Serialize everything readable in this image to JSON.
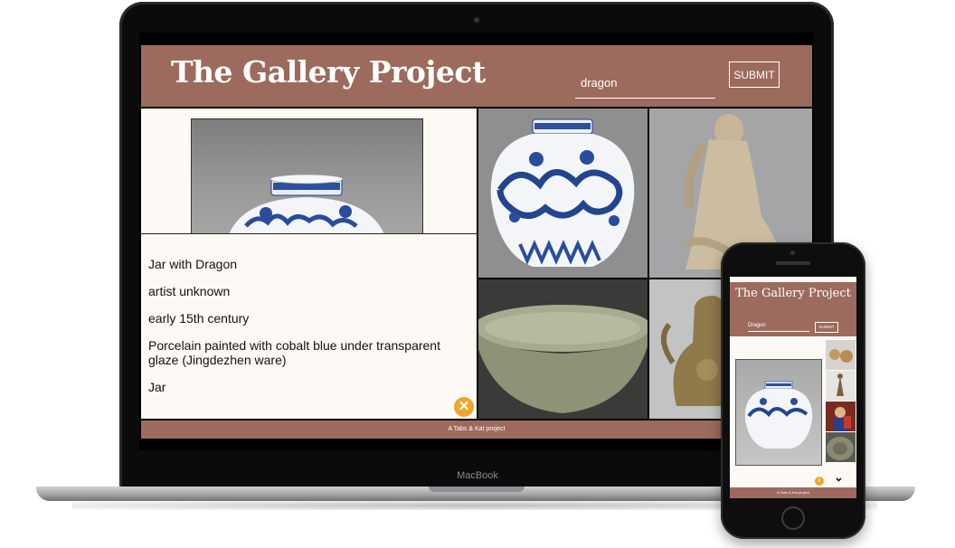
{
  "laptop": {
    "brand_label": "MacBook"
  },
  "site": {
    "title": "The Gallery Project",
    "search": {
      "value": "dragon",
      "placeholder": ""
    },
    "submit_label": "SUBMIT",
    "footer_text": "A Tabs & Kat project"
  },
  "artwork": {
    "title": "Jar with Dragon",
    "artist": "artist unknown",
    "date": "early 15th century",
    "medium": "Porcelain painted with cobalt blue under transparent glaze (Jingdezhen ware)",
    "classification": "Jar",
    "close_icon": "close-icon",
    "close_glyph": "✕"
  },
  "thumbnails": [
    {
      "subject": "blue and white porcelain jar with dragon"
    },
    {
      "subject": "stone sculpture of seated figure"
    },
    {
      "subject": "celadon bowl"
    },
    {
      "subject": "bronze ewer"
    }
  ],
  "phone": {
    "title": "The Gallery Project",
    "search_value": "Dragon",
    "submit_label": "SUBMIT",
    "footer_text": "A Tabs & Kat project",
    "info_glyph": "i",
    "chevron_glyph": "⌄"
  },
  "colors": {
    "header_bg": "#9c6b5e",
    "panel_bg": "#fdfaf6",
    "accent": "#f0a52b",
    "porcelain_blue": "#1f3f8f"
  }
}
